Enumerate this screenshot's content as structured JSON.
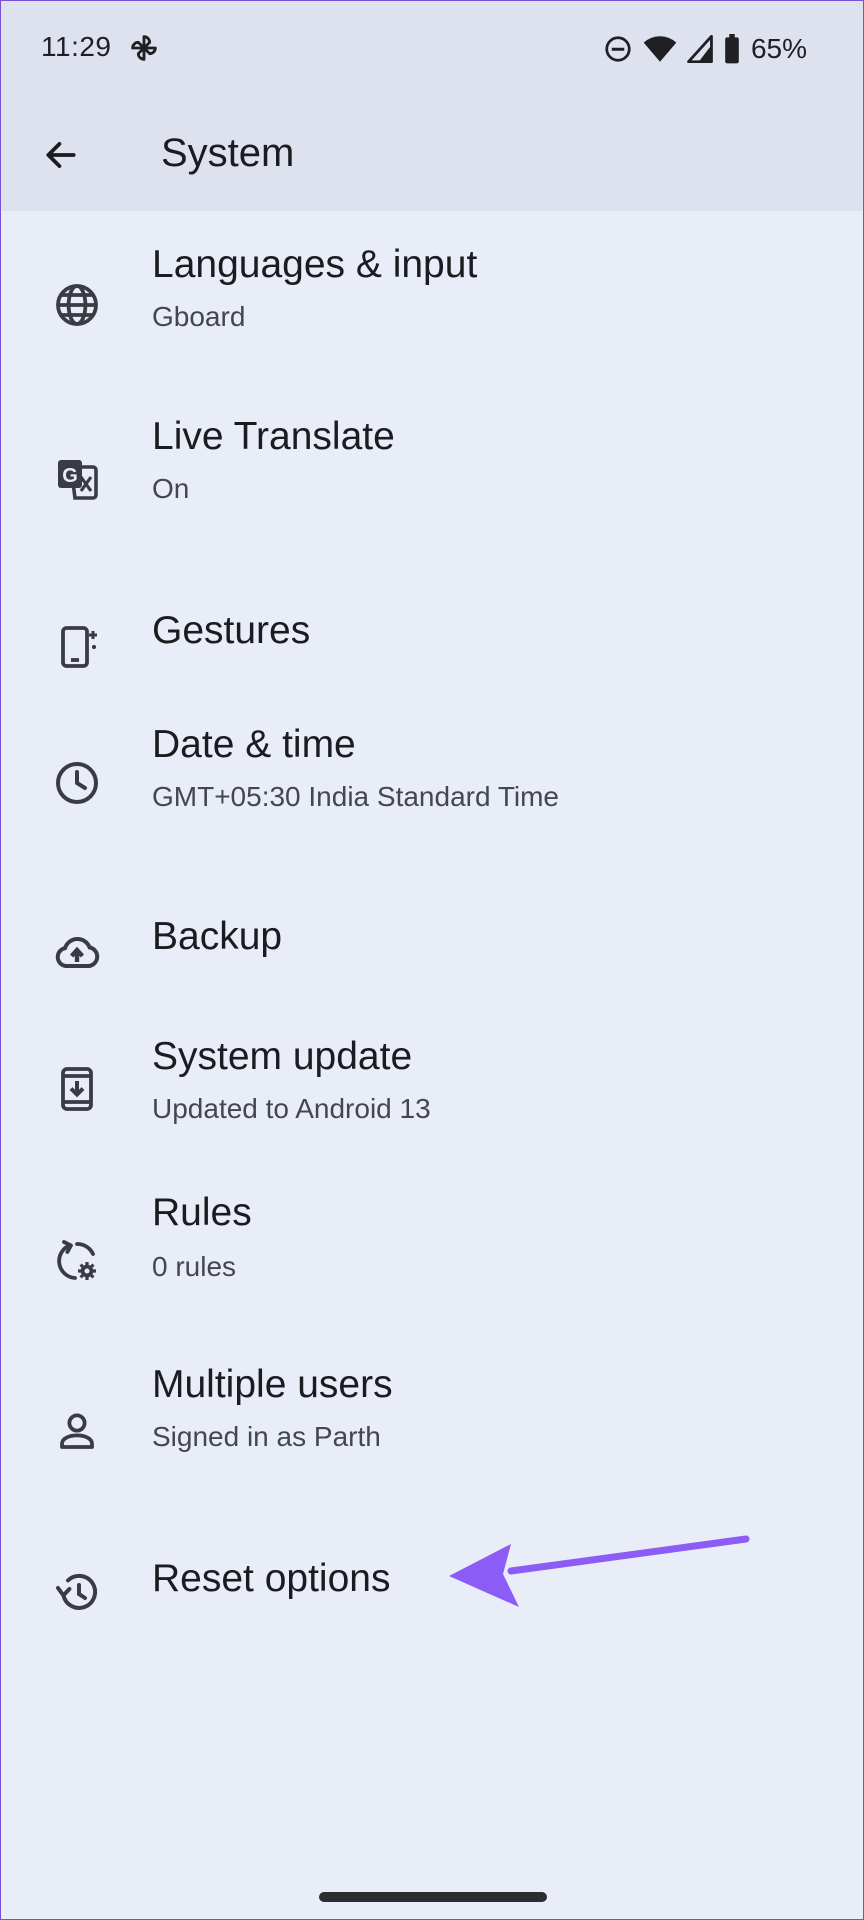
{
  "status_bar": {
    "time": "11:29",
    "battery_pct": "65%"
  },
  "app_bar": {
    "title": "System",
    "back_icon": "arrow-left-icon"
  },
  "items": [
    {
      "label": "Languages & input",
      "sub": "Gboard",
      "icon": "globe-icon"
    },
    {
      "label": "Live Translate",
      "sub": "On",
      "icon": "translate-icon"
    },
    {
      "label": "Gestures",
      "sub": "",
      "icon": "gestures-phone-icon"
    },
    {
      "label": "Date & time",
      "sub": "GMT+05:30 India Standard Time",
      "icon": "clock-icon"
    },
    {
      "label": "Backup",
      "sub": "",
      "icon": "cloud-upload-icon"
    },
    {
      "label": "System update",
      "sub": "Updated to Android 13",
      "icon": "system-update-icon"
    },
    {
      "label": "Rules",
      "sub": "0 rules",
      "icon": "rules-gear-icon"
    },
    {
      "label": "Multiple users",
      "sub": "Signed in as Parth",
      "icon": "person-icon"
    },
    {
      "label": "Reset options",
      "sub": "",
      "icon": "history-icon"
    }
  ],
  "annotation": {
    "arrow_color": "#8b5cf6"
  }
}
